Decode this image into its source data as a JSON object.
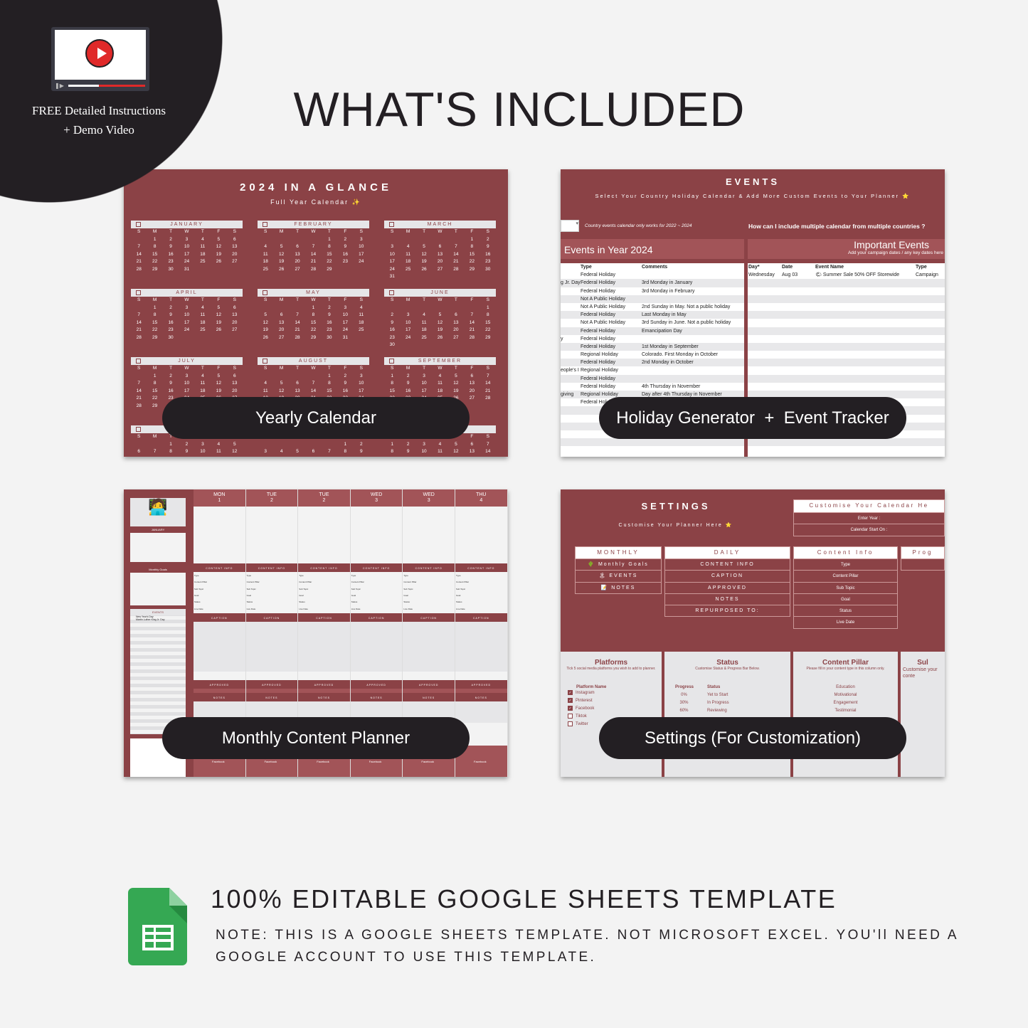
{
  "promo": {
    "line1": "FREE Detailed Instructions",
    "line2": "+ Demo Video",
    "icon": "video-play-icon"
  },
  "title": "WHAT'S INCLUDED",
  "colors": {
    "panel": "#8b4246",
    "dark": "#231f23",
    "background": "#f3f3f3",
    "play": "#e02929",
    "sheets_green": "#35a853"
  },
  "yearly": {
    "label": "Yearly Calendar",
    "title": "2024 IN A GLANCE",
    "subtitle": "Full Year Calendar ✨",
    "weekdays": [
      "S",
      "M",
      "T",
      "W",
      "T",
      "F",
      "S"
    ],
    "months": [
      {
        "name": "JANUARY",
        "first_weekday": 1,
        "days": 31
      },
      {
        "name": "FEBRUARY",
        "first_weekday": 4,
        "days": 29
      },
      {
        "name": "MARCH",
        "first_weekday": 5,
        "days": 31
      },
      {
        "name": "APRIL",
        "first_weekday": 1,
        "days": 30
      },
      {
        "name": "MAY",
        "first_weekday": 3,
        "days": 31
      },
      {
        "name": "JUNE",
        "first_weekday": 6,
        "days": 30
      },
      {
        "name": "JULY",
        "first_weekday": 1,
        "days": 31
      },
      {
        "name": "AUGUST",
        "first_weekday": 4,
        "days": 31
      },
      {
        "name": "SEPTEMBER",
        "first_weekday": 0,
        "days": 30
      },
      {
        "name": "",
        "first_weekday": 2,
        "days": 31
      },
      {
        "name": "",
        "first_weekday": 5,
        "days": 30
      },
      {
        "name": "",
        "first_weekday": 0,
        "days": 31
      }
    ]
  },
  "events": {
    "label": "Holiday Generator  +  Event Tracker",
    "title": "EVENTS",
    "subtitle": "Select Your Country Holiday Calendar & Add More Custom Events to Your Planner ⭐",
    "note": "Country events calendar only works for 2022 ~ 2024",
    "help": "How can I include multiple calendar from multiple countries ?",
    "left_title": "Events in Year 2024",
    "right_title": "Important Events",
    "right_sub": "Add your campaign dates / any key dates here",
    "left_headers": [
      "",
      "Type",
      "Comments"
    ],
    "left_rows": [
      [
        "",
        "Federal Holiday",
        ""
      ],
      [
        "g Jr. Day",
        "Federal Holiday",
        "3rd Monday in January"
      ],
      [
        "",
        "Federal Holiday",
        "3rd Monday in February"
      ],
      [
        "",
        "Not A Public Holiday",
        ""
      ],
      [
        "",
        "Not A Public Holiday",
        "2nd Sunday in May. Not a public holiday"
      ],
      [
        "",
        "Federal Holiday",
        "Last Monday in May"
      ],
      [
        "",
        "Not A Public Holiday",
        "3rd Sunday in June. Not a public holiday"
      ],
      [
        "",
        "Federal Holiday",
        "Emancipation Day"
      ],
      [
        "y",
        "Federal Holiday",
        ""
      ],
      [
        "",
        "Federal Holiday",
        "1st Monday in September"
      ],
      [
        "",
        "Regional Holiday",
        "Colorado. First Monday in October"
      ],
      [
        "",
        "Federal Holiday",
        "2nd Monday in October"
      ],
      [
        "eople's I",
        "Regional Holiday",
        ""
      ],
      [
        "",
        "Federal Holiday",
        ""
      ],
      [
        "",
        "Federal Holiday",
        "4th Thursday in November"
      ],
      [
        "giving",
        "Regional Holiday",
        "Day after 4th Thursday in November"
      ],
      [
        "",
        "Federal Holiday",
        ""
      ]
    ],
    "right_headers": [
      "Day*",
      "Date",
      "Event Name",
      "Type"
    ],
    "right_rows": [
      [
        "Wednesday",
        "Aug 03",
        "🌤 Summer Sale 50% OFF Storewide",
        "Campaign"
      ]
    ]
  },
  "planner": {
    "label": "Monthly Content Planner",
    "month": "JANUARY",
    "days": [
      {
        "d": "MON",
        "n": "1"
      },
      {
        "d": "TUE",
        "n": "2"
      },
      {
        "d": "TUE",
        "n": "2"
      },
      {
        "d": "WED",
        "n": "3"
      },
      {
        "d": "WED",
        "n": "3"
      },
      {
        "d": "THU",
        "n": "4"
      }
    ],
    "content_info": "CONTENT INFO",
    "caption": "CAPTION",
    "approved": "APPROVED",
    "notes": "NOTES",
    "fields": [
      "Type",
      "Content Pillar",
      "Sub Topic",
      "Goal",
      "Status",
      "Live Date"
    ],
    "platform": "Facebook",
    "monthly_goals": "Monthly Goals",
    "events": "EVENTS",
    "event_items": [
      "New Year's Day",
      "Martin Luther King Jr. Day"
    ]
  },
  "settings": {
    "label": "Settings (For Customization)",
    "title": "SETTINGS",
    "subtitle": "Customise Your Planner Here ⭐",
    "customise": "Customise Your Calendar He",
    "enter_year": "Enter Year :",
    "start_on": "Calendar Start On :",
    "monthly": {
      "h": "MONTHLY",
      "items": [
        "🌵 Monthly Goals",
        "🏝 EVENTS",
        "📝 NOTES"
      ]
    },
    "daily": {
      "h": "DAILY",
      "items": [
        "CONTENT INFO",
        "CAPTION",
        "APPROVED",
        "NOTES",
        "REPURPOSED TO:"
      ]
    },
    "content_info": {
      "h": "Content Info",
      "items": [
        "Type",
        "Content Pillar",
        "Sub Topic",
        "Goal",
        "Status",
        "Live Date"
      ]
    },
    "prog": "Prog",
    "platforms": {
      "h": "Platforms",
      "sub": "Tick 5 social media platforms you wish to add to planner.",
      "col": "Platform Name",
      "items": [
        {
          "name": "Instagram",
          "checked": true
        },
        {
          "name": "Pinterest",
          "checked": true
        },
        {
          "name": "Facebook",
          "checked": true
        },
        {
          "name": "Tiktok",
          "checked": false
        },
        {
          "name": "Twitter",
          "checked": false
        }
      ]
    },
    "status": {
      "h": "Status",
      "sub": "Customise Status & Progress Bar Below.",
      "cols": [
        "Progress",
        "Status"
      ],
      "rows": [
        [
          "0%",
          "Yet to Start"
        ],
        [
          "30%",
          "In Progress"
        ],
        [
          "60%",
          "Reviewing"
        ]
      ]
    },
    "pillar": {
      "h": "Content Pillar",
      "sub": "Please fill in your content type in this column only.",
      "items": [
        "Education",
        "Motivational",
        "Engagement",
        "Testimonial"
      ]
    },
    "sub": {
      "h": "Sul",
      "sub": "Customise your conte"
    }
  },
  "footer": {
    "heading": "100% EDITABLE GOOGLE SHEETS TEMPLATE",
    "note1": "NOTE: THIS IS A GOOGLE SHEETS TEMPLATE. NOT MICROSOFT EXCEL. YOU'll NEED A",
    "note2": "GOOGLE ACCOUNT TO USE THIS TEMPLATE.",
    "icon": "google-sheets-icon"
  }
}
